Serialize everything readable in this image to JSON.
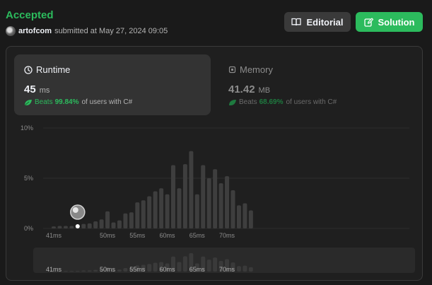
{
  "submission": {
    "status": "Accepted",
    "username": "artofcom",
    "submitted_text": "submitted at May 27, 2024 09:05"
  },
  "buttons": {
    "editorial": "Editorial",
    "solution": "Solution"
  },
  "icons": {
    "editorial": "book-icon",
    "solution": "edit-icon",
    "runtime": "clock-icon",
    "memory": "chip-icon",
    "beats": "leaf-icon"
  },
  "runtime": {
    "label": "Runtime",
    "value": "45",
    "unit": "ms",
    "beats_label": "Beats",
    "beats_value": "99.84%",
    "beats_suffix": "of users with C#"
  },
  "memory": {
    "label": "Memory",
    "value": "41.42",
    "unit": "MB",
    "beats_label": "Beats",
    "beats_value": "68.69%",
    "beats_suffix": "of users with C#"
  },
  "colors": {
    "accent": "#2cbb5d",
    "background": "#1a1a1a",
    "bar": "#3e3e3e",
    "text": "#eff1f6"
  },
  "chart_data": {
    "type": "bar",
    "x_unit": "ms",
    "x": [
      41,
      42,
      43,
      44,
      45,
      46,
      47,
      48,
      49,
      50,
      51,
      52,
      53,
      54,
      55,
      56,
      57,
      58,
      59,
      60,
      61,
      62,
      63,
      64,
      65,
      66,
      67,
      68,
      69,
      70,
      71,
      72,
      73,
      74,
      75
    ],
    "values": [
      0.2,
      0.25,
      0.25,
      0.25,
      0.3,
      0.45,
      0.5,
      0.7,
      0.9,
      1.7,
      0.6,
      0.8,
      1.5,
      1.6,
      2.6,
      2.8,
      3.2,
      3.7,
      4.0,
      3.4,
      6.3,
      4.0,
      6.4,
      7.7,
      3.4,
      6.3,
      5.0,
      5.9,
      4.5,
      5.2,
      3.8,
      2.3,
      2.5,
      1.8
    ],
    "y_ticks": [
      "10%",
      "5%",
      "0%"
    ],
    "ylim": [
      0,
      10
    ],
    "x_tick_labels": [
      "41ms",
      "50ms",
      "55ms",
      "60ms",
      "65ms",
      "70ms"
    ],
    "x_tick_values": [
      41,
      50,
      55,
      60,
      65,
      70
    ],
    "highlight_x": 45
  }
}
